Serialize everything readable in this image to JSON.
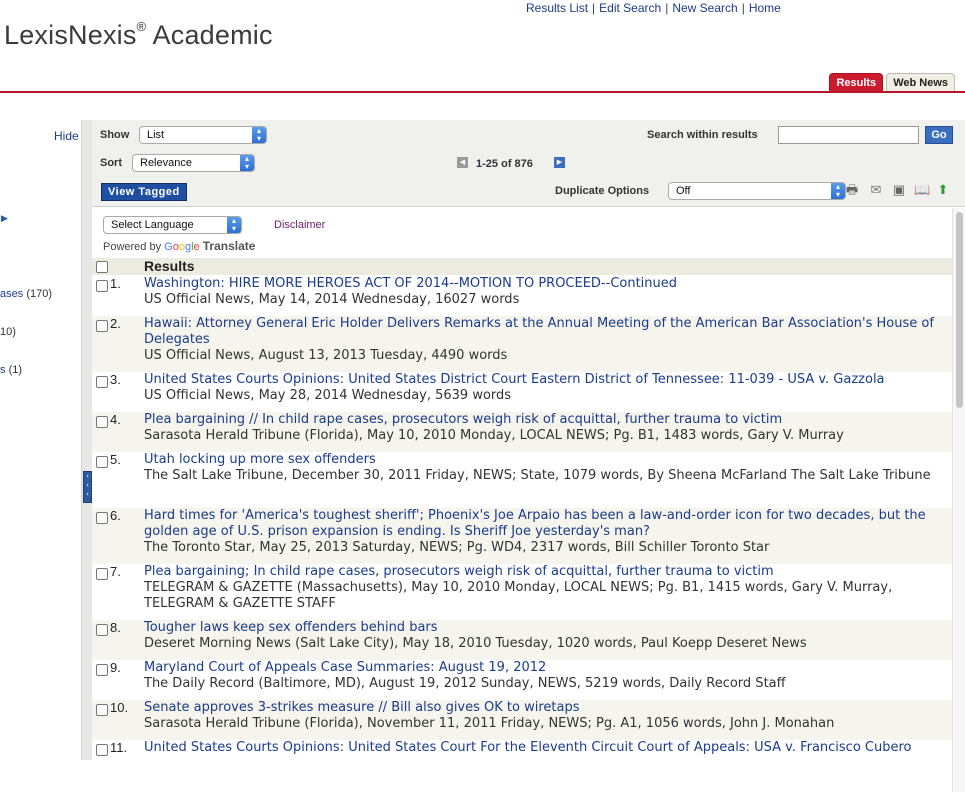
{
  "top_nav": [
    "Results List",
    "Edit Search",
    "New Search",
    "Home"
  ],
  "logo": {
    "name": "LexisNexis",
    "reg": "®",
    "suffix": " Academic"
  },
  "tabs": [
    {
      "label": "Results",
      "active": true
    },
    {
      "label": "Web News",
      "active": false
    }
  ],
  "sidebar": {
    "hide_label": "Hide",
    "items": [
      {
        "label": "ases",
        "count": "(170)"
      },
      {
        "label": "",
        "count": "10)"
      },
      {
        "label": "s",
        "count": "(1)"
      }
    ]
  },
  "toolbar": {
    "show_label": "Show",
    "show_value": "List",
    "sort_label": "Sort",
    "sort_value": "Relevance",
    "pager": {
      "range": "1-25",
      "of_label": "of",
      "total": "876"
    },
    "search_within_label": "Search within results",
    "search_within_value": "",
    "go_label": "Go",
    "view_tagged_label": "View Tagged",
    "duplicate_label": "Duplicate Options",
    "duplicate_value": "Off"
  },
  "translate": {
    "select_label": "Select Language",
    "disclaimer": "Disclaimer",
    "powered_by": "Powered by",
    "google": "Google",
    "translate": "Translate"
  },
  "results_header": "Results",
  "results": [
    {
      "num": "1.",
      "title": "Washington: HIRE MORE HEROES ACT OF 2014--MOTION TO PROCEED--Continued",
      "meta": "US Official News, May 14, 2014 Wednesday, 16027 words"
    },
    {
      "num": "2.",
      "title": "Hawaii: Attorney General Eric Holder Delivers Remarks at the Annual Meeting of the American Bar Association's House of Delegates",
      "meta": "US Official News, August 13, 2013 Tuesday, 4490 words"
    },
    {
      "num": "3.",
      "title": "United States Courts Opinions: United States District Court Eastern District of Tennessee: 11-039 - USA v. Gazzola",
      "meta": "US Official News, May 28, 2014 Wednesday, 5639 words"
    },
    {
      "num": "4.",
      "title": "Plea bargaining // In child rape cases, prosecutors weigh risk of acquittal, further trauma to victim",
      "meta": "Sarasota Herald Tribune (Florida), May 10, 2010 Monday, LOCAL NEWS; Pg. B1, 1483 words, Gary V. Murray"
    },
    {
      "num": "5.",
      "title": "Utah locking up more sex offenders",
      "meta": "The Salt Lake Tribune, December 30, 2011 Friday, NEWS; State, 1079 words, By Sheena McFarland The Salt Lake Tribune"
    },
    {
      "num": "6.",
      "title": "Hard times for 'America's toughest sheriff'; Phoenix's Joe Arpaio has been a law-and-order icon for two decades, but the golden age of U.S. prison expansion is ending. Is Sheriff Joe yesterday's man?",
      "meta": "The Toronto Star, May 25, 2013 Saturday, NEWS; Pg. WD4, 2317 words, Bill Schiller Toronto Star"
    },
    {
      "num": "7.",
      "title": "Plea bargaining; In child rape cases, prosecutors weigh risk of acquittal, further trauma to victim",
      "meta": "TELEGRAM & GAZETTE (Massachusetts), May 10, 2010 Monday, LOCAL NEWS; Pg. B1, 1415 words, Gary V. Murray, TELEGRAM & GAZETTE STAFF"
    },
    {
      "num": "8.",
      "title": "Tougher laws keep sex offenders behind bars",
      "meta": "Deseret Morning News (Salt Lake City), May 18, 2010 Tuesday, 1020 words, Paul Koepp Deseret News"
    },
    {
      "num": "9.",
      "title": "Maryland Court of Appeals Case Summaries: August 19, 2012",
      "meta": "The Daily Record (Baltimore, MD), August 19, 2012 Sunday, NEWS, 5219 words, Daily Record Staff"
    },
    {
      "num": "10.",
      "title": "Senate approves 3-strikes measure // Bill also gives OK to wiretaps",
      "meta": "Sarasota Herald Tribune (Florida), November 11, 2011 Friday, NEWS; Pg. A1, 1056 words, John J. Monahan"
    },
    {
      "num": "11.",
      "title": "United States Courts Opinions: United States Court For the Eleventh Circuit Court of Appeals: USA v. Francisco Cubero",
      "meta": ""
    }
  ]
}
